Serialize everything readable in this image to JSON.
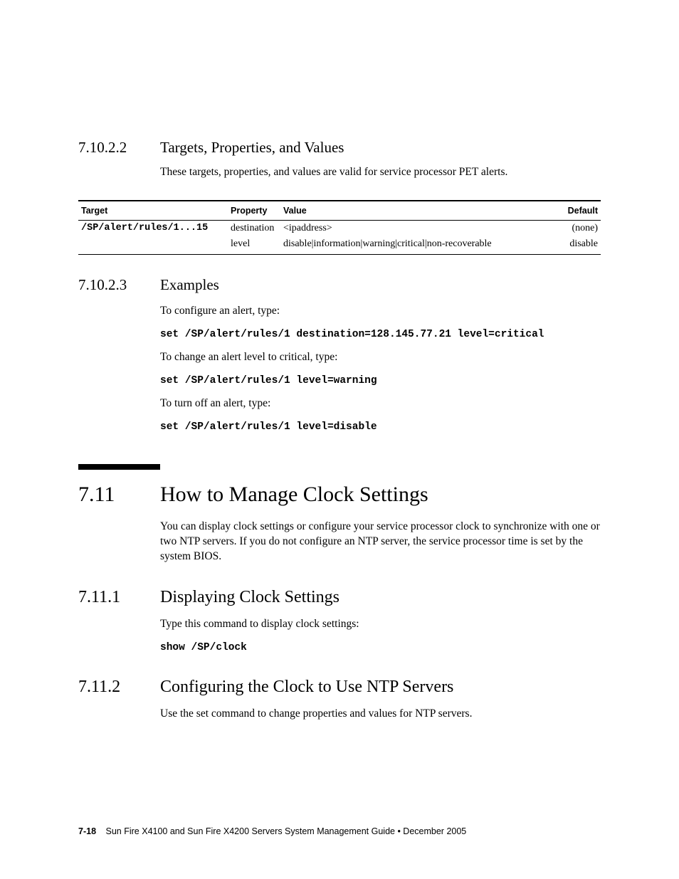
{
  "sections": {
    "s7_10_2_2": {
      "num": "7.10.2.2",
      "title": "Targets, Properties, and Values"
    },
    "s7_10_2_3": {
      "num": "7.10.2.3",
      "title": "Examples"
    },
    "s7_11": {
      "num": "7.11",
      "title": "How to Manage Clock Settings"
    },
    "s7_11_1": {
      "num": "7.11.1",
      "title": "Displaying Clock Settings"
    },
    "s7_11_2": {
      "num": "7.11.2",
      "title": "Configuring the Clock to Use NTP Servers"
    }
  },
  "para": {
    "p1": "These targets, properties, and values are valid for service processor PET alerts.",
    "p2": "To configure an alert, type:",
    "p3": "To change an alert level to critical, type:",
    "p4": "To turn off an alert, type:",
    "p5": "You can display clock settings or configure your service processor clock to synchronize with one or two NTP servers. If you do not configure an NTP server, the service processor time is set by the system BIOS.",
    "p6": "Type this command to display clock settings:",
    "p7": "Use the set command to change properties and values for NTP servers."
  },
  "code": {
    "c1": "set /SP/alert/rules/1 destination=128.145.77.21 level=critical",
    "c2": "set /SP/alert/rules/1 level=warning",
    "c3": "set /SP/alert/rules/1 level=disable",
    "c4": "show /SP/clock"
  },
  "table": {
    "headers": {
      "target": "Target",
      "property": "Property",
      "value": "Value",
      "default": "Default"
    },
    "rows": [
      {
        "target": "/SP/alert/rules/1...15",
        "property": "destination",
        "value": "<ipaddress>",
        "default": "(none)"
      },
      {
        "target": "",
        "property": "level",
        "value": "disable|information|warning|critical|non-recoverable",
        "default": "disable"
      }
    ]
  },
  "footer": {
    "pagenum": "7-18",
    "text": "Sun Fire X4100 and Sun Fire X4200 Servers System Management Guide • December 2005"
  }
}
